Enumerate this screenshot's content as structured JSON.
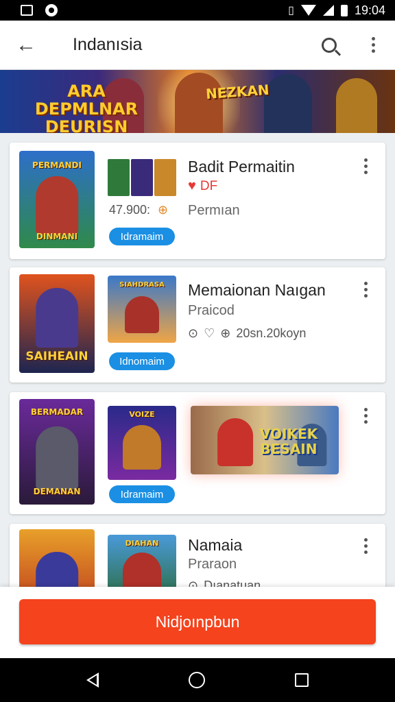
{
  "status_bar": {
    "time": "19:04"
  },
  "header": {
    "title": "Indanısia"
  },
  "banner": {
    "left_text": "ARA DEPMLNAR DEURISN",
    "right_text": "NEZKAN"
  },
  "cards": [
    {
      "title": "Badit Permaitin",
      "badge": "DF",
      "price": "47.900:",
      "sub": "Permıan",
      "pill": "Idramaim",
      "thumb1_caption": "PERMANDI",
      "thumb1_bottom": "DINMANI"
    },
    {
      "title": "Memaionan Naıgan",
      "sub": "Praicod",
      "meta": "20sn.20koyn",
      "pill": "Idnomaim",
      "thumb1_caption": "SAIHEAIN",
      "thumb2_caption": "SIAHDRASA"
    },
    {
      "pill": "Idramaim",
      "thumb1_caption": "BERMADAR",
      "thumb1_bottom": "DEMANAN",
      "thumb2_caption": "VOIZE",
      "promo_text": "VOIKEK BESAIN"
    },
    {
      "title": "Namaia",
      "sub": "Praraon",
      "meta": "Dıanatuan",
      "thumb2_caption": "DIAHAN"
    }
  ],
  "cta": {
    "label": "Nidjoınpbun"
  },
  "colors": {
    "accent": "#f4431d",
    "pill": "#1a8fe3",
    "heart": "#e53935"
  }
}
